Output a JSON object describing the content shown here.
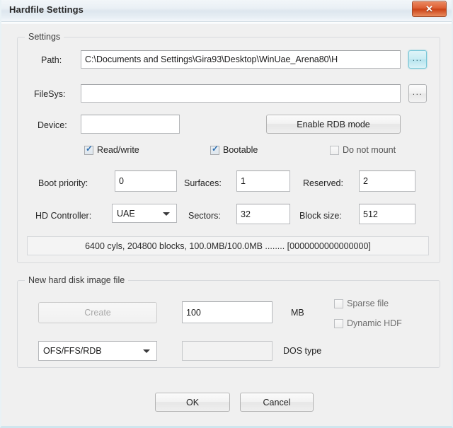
{
  "window": {
    "title": "Hardfile Settings",
    "close_label": "✕"
  },
  "settings_group": {
    "legend": "Settings",
    "path": {
      "label": "Path:",
      "value": "C:\\Documents and Settings\\Gira93\\Desktop\\WinUae_Arena80\\H",
      "browse_label": "..."
    },
    "filesys": {
      "label": "FileSys:",
      "value": "",
      "browse_label": "..."
    },
    "device": {
      "label": "Device:",
      "value": ""
    },
    "enable_rdb_button": "Enable RDB mode",
    "checkboxes": [
      {
        "label": "Read/write",
        "checked": true,
        "tick": "✓"
      },
      {
        "label": "Bootable",
        "checked": true,
        "tick": "✓"
      },
      {
        "label": "Do not mount",
        "checked": false,
        "tick": ""
      }
    ],
    "boot_priority": {
      "label": "Boot priority:",
      "value": "0"
    },
    "surfaces": {
      "label": "Surfaces:",
      "value": "1"
    },
    "reserved": {
      "label": "Reserved:",
      "value": "2"
    },
    "hd_controller": {
      "label": "HD Controller:",
      "value": "UAE"
    },
    "sectors": {
      "label": "Sectors:",
      "value": "32"
    },
    "block_size": {
      "label": "Block size:",
      "value": "512"
    },
    "geometry_info": "6400 cyls, 204800 blocks, 100.0MB/100.0MB ........ [0000000000000000]"
  },
  "new_image_group": {
    "legend": "New hard disk image file",
    "create_button": "Create",
    "size": {
      "value": "100",
      "unit_label": "MB"
    },
    "sparse_file": {
      "label": "Sparse file",
      "checked": false
    },
    "dynamic_hdf": {
      "label": "Dynamic HDF",
      "checked": false
    },
    "filesystem": {
      "value": "OFS/FFS/RDB"
    },
    "dos_type": {
      "value": "",
      "label": "DOS type"
    }
  },
  "footer": {
    "ok_label": "OK",
    "cancel_label": "Cancel"
  }
}
